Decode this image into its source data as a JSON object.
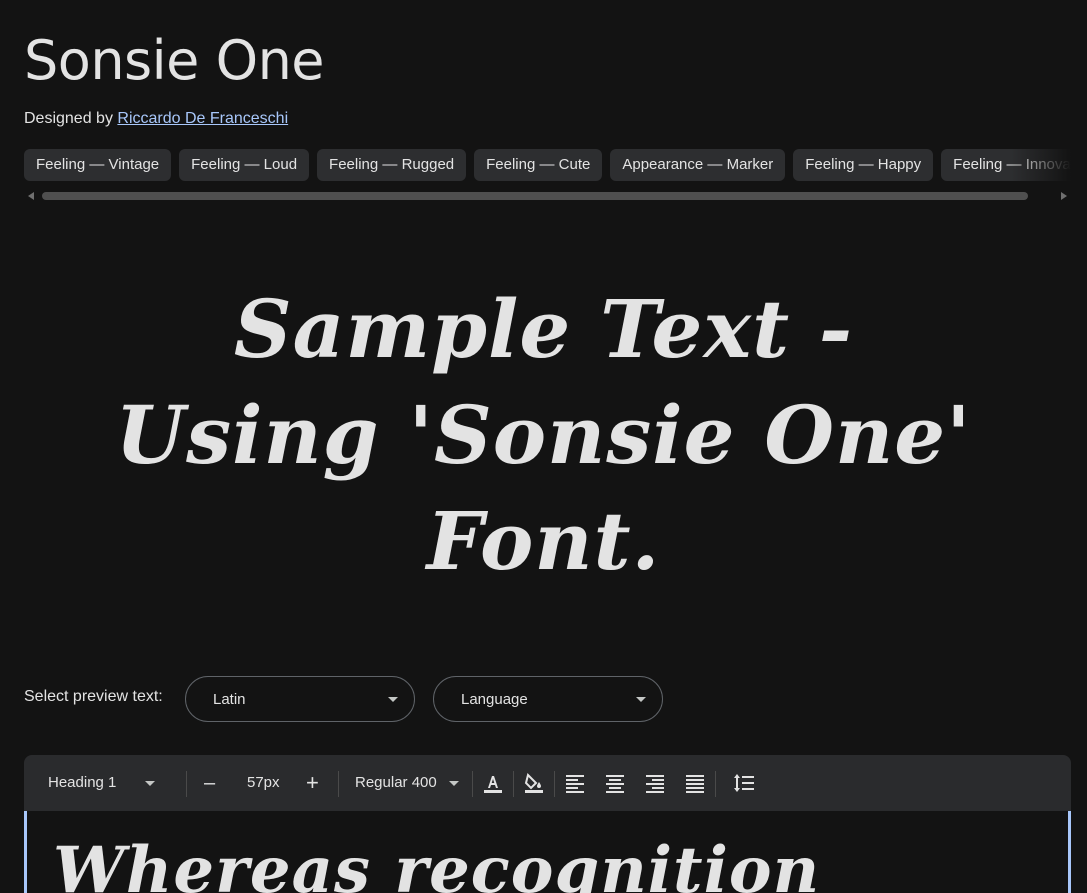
{
  "font": {
    "name": "Sonsie One",
    "designed_by_label": "Designed by",
    "designer": "Riccardo De Franceschi"
  },
  "tags": [
    "Feeling — Vintage",
    "Feeling — Loud",
    "Feeling — Rugged",
    "Feeling — Cute",
    "Appearance — Marker",
    "Feeling — Happy",
    "Feeling — Innovative"
  ],
  "preview": {
    "sample_text": "Sample Text - Using 'Sonsie One' Font.",
    "select_label": "Select preview text:",
    "script_value": "Latin",
    "language_value": "Language"
  },
  "toolbar": {
    "style": "Heading 1",
    "size": "57px",
    "weight": "Regular 400",
    "minus": "–",
    "plus": "+"
  },
  "editor": {
    "text": "Whereas recognition"
  },
  "colors": {
    "background": "#131313",
    "text": "#e3e3e3",
    "link": "#a8c7fa",
    "chip": "#2d2e30",
    "toolbar": "#2a2b2d"
  }
}
